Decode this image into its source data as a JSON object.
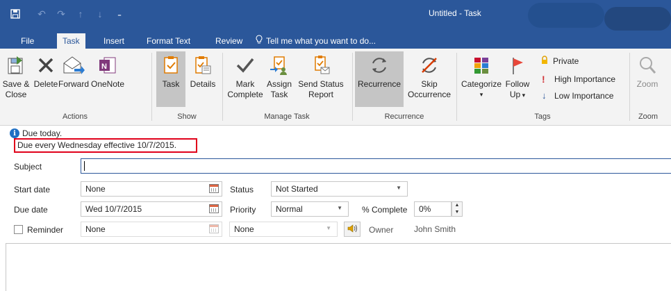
{
  "window": {
    "title": "Untitled - Task"
  },
  "qat": {
    "icons": [
      "save-icon",
      "undo-icon",
      "redo-icon",
      "up-icon",
      "down-icon",
      "customize-icon"
    ]
  },
  "tabs": [
    {
      "label": "File"
    },
    {
      "label": "Task"
    },
    {
      "label": "Insert"
    },
    {
      "label": "Format Text"
    },
    {
      "label": "Review"
    },
    {
      "label": "Tell me what you want to do..."
    }
  ],
  "ribbon": {
    "actions": {
      "group": "Actions",
      "save_close": [
        "Save &",
        "Close"
      ],
      "delete": "Delete",
      "forward": "Forward",
      "onenote": "OneNote"
    },
    "show": {
      "group": "Show",
      "task": "Task",
      "details": "Details"
    },
    "manage": {
      "group": "Manage Task",
      "mark_complete": [
        "Mark",
        "Complete"
      ],
      "assign_task": [
        "Assign",
        "Task"
      ],
      "send_status": [
        "Send Status",
        "Report"
      ]
    },
    "recurrence": {
      "group": "Recurrence",
      "recurrence": "Recurrence",
      "skip": [
        "Skip",
        "Occurrence"
      ]
    },
    "tags": {
      "group": "Tags",
      "categorize": "Categorize",
      "follow_up": [
        "Follow",
        "Up"
      ],
      "private": "Private",
      "high": "High Importance",
      "low": "Low Importance"
    },
    "zoom": {
      "group": "Zoom",
      "zoom": "Zoom"
    }
  },
  "info": {
    "due": "Due today.",
    "recurrence": "Due every Wednesday effective 10/7/2015."
  },
  "form": {
    "subject_label": "Subject",
    "subject_value": "",
    "start_label": "Start date",
    "start_value": "None",
    "due_label": "Due date",
    "due_value": "Wed 10/7/2015",
    "status_label": "Status",
    "status_value": "Not Started",
    "priority_label": "Priority",
    "priority_value": "Normal",
    "complete_label": "% Complete",
    "complete_value": "0%",
    "reminder_label": "Reminder",
    "reminder_date": "None",
    "reminder_time": "None",
    "owner_label": "Owner",
    "owner_value": "John Smith"
  }
}
